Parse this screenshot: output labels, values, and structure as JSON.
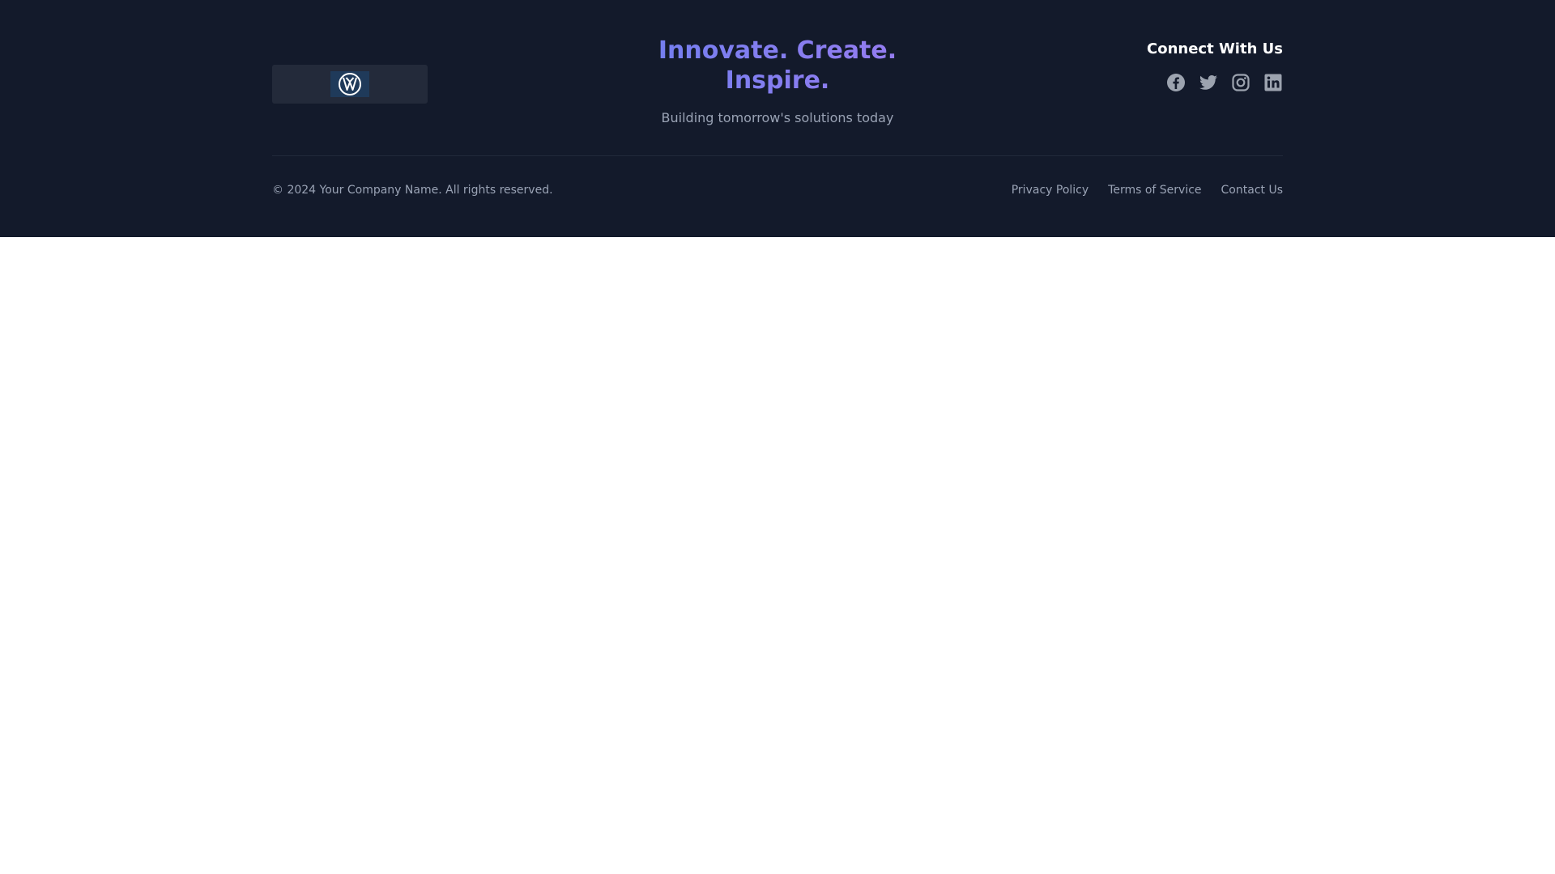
{
  "footer": {
    "logo": {
      "icon": "vw-logo-icon",
      "badge_color": "#1f3a5a"
    },
    "tagline_line1": "Innovate. Create.",
    "tagline_line2": "Inspire.",
    "subtitle": "Building tomorrow's solutions today",
    "connect_title": "Connect With Us",
    "social": [
      {
        "icon": "facebook-icon"
      },
      {
        "icon": "twitter-icon"
      },
      {
        "icon": "instagram-icon"
      },
      {
        "icon": "linkedin-icon"
      }
    ],
    "copyright": "© 2024 Your Company Name. All rights reserved.",
    "links": [
      "Privacy Policy",
      "Terms of Service",
      "Contact Us"
    ]
  },
  "colors": {
    "background": "#131a2b",
    "gradient_start": "#6f7ff0",
    "gradient_end": "#9a7cf0",
    "muted_text": "#9aa3b5",
    "icon_color": "#9ca3af"
  }
}
